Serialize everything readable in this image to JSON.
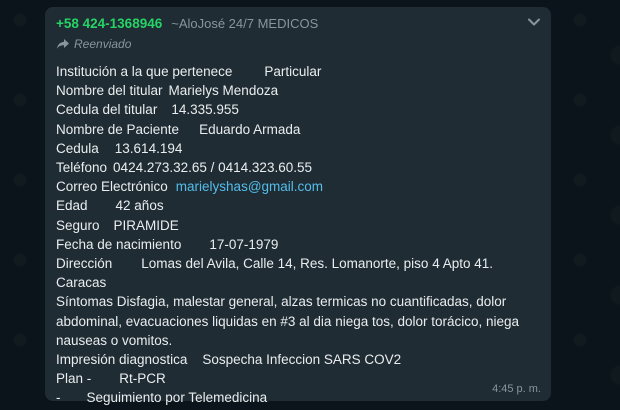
{
  "message": {
    "sender_phone": "+58 424-1368946",
    "sender_name": "~AloJosé 24/7 MEDICOS",
    "forwarded_label": "Reenviado",
    "timestamp": "4:45 p. m.",
    "fields": {
      "institucion_label": "Institución a la que pertenece",
      "institucion_value": "Particular",
      "titular_label": "Nombre del titular",
      "titular_value": "Marielys Mendoza",
      "cedula_titular_label": "Cedula del titular",
      "cedula_titular_value": "14.335.955",
      "paciente_label": "Nombre de Paciente",
      "paciente_value": "Eduardo Armada",
      "cedula_label": "Cedula",
      "cedula_value": "13.614.194",
      "telefono_label": "Teléfono",
      "telefono_value": "0424.273.32.65 / 0414.323.60.55",
      "correo_label": "Correo Electrónico",
      "correo_value": "marielyshas@gmail.com",
      "edad_label": "Edad",
      "edad_value": "42 años",
      "seguro_label": "Seguro",
      "seguro_value": "PIRAMIDE",
      "nacimiento_label": "Fecha de nacimiento",
      "nacimiento_value": "17-07-1979",
      "direccion_label": "Dirección",
      "direccion_value": "Lomas del Avila, Calle 14, Res. Lomanorte, piso 4 Apto 41.",
      "direccion_city": "Caracas",
      "sintomas_label": "Síntomas",
      "sintomas_value": "Disfagia, malestar general, alzas termicas no cuantificadas, dolor abdominal, evacuaciones liquidas en #3 al dia niega tos, dolor torácico, niega nauseas o vomitos.",
      "impresion_label": "Impresión diagnostica",
      "impresion_value": "Sospecha Infeccion SARS COV2",
      "plan_label": "Plan -",
      "plan_value": "Rt-PCR",
      "plan2_label": "-",
      "plan2_value": "Seguimiento por Telemedicina"
    }
  },
  "colors": {
    "background": "#0b141a",
    "bubble": "#202c33",
    "sender_phone": "#25d366",
    "link": "#53bdeb",
    "meta_text": "#8696a0",
    "body_text": "#e9edef"
  },
  "icons": {
    "forward": "forward-arrow-icon",
    "menu": "chevron-down-icon"
  }
}
